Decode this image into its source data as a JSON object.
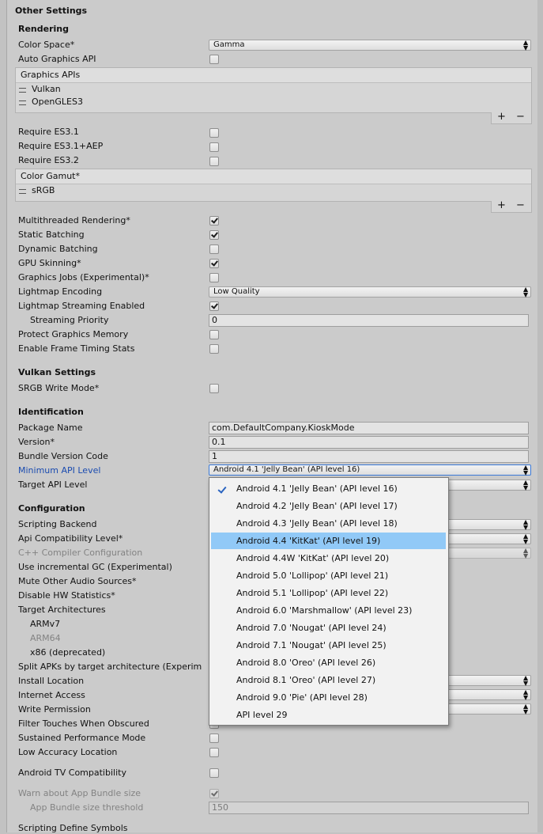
{
  "section_title": "Other Settings",
  "rendering": {
    "header": "Rendering",
    "color_space_label": "Color Space*",
    "color_space_value": "Gamma",
    "auto_graphics_api_label": "Auto Graphics API",
    "auto_graphics_api": false,
    "graphics_apis_header": "Graphics APIs",
    "graphics_apis": [
      "Vulkan",
      "OpenGLES3"
    ],
    "require_es31_label": "Require ES3.1",
    "require_es31_aep_label": "Require ES3.1+AEP",
    "require_es32_label": "Require ES3.2",
    "color_gamut_header": "Color Gamut*",
    "color_gamut": [
      "sRGB"
    ],
    "multithreaded_label": "Multithreaded Rendering*",
    "static_batching_label": "Static Batching",
    "dynamic_batching_label": "Dynamic Batching",
    "gpu_skinning_label": "GPU Skinning*",
    "graphics_jobs_label": "Graphics Jobs (Experimental)*",
    "lightmap_encoding_label": "Lightmap Encoding",
    "lightmap_encoding_value": "Low Quality",
    "lightmap_streaming_label": "Lightmap Streaming Enabled",
    "streaming_priority_label": "Streaming Priority",
    "streaming_priority_value": "0",
    "protect_graphics_memory_label": "Protect Graphics Memory",
    "frame_timing_label": "Enable Frame Timing Stats"
  },
  "vulkan": {
    "header": "Vulkan Settings",
    "srgb_write_label": "SRGB Write Mode*"
  },
  "identification": {
    "header": "Identification",
    "package_name_label": "Package Name",
    "package_name_value": "com.DefaultCompany.KioskMode",
    "version_label": "Version*",
    "version_value": "0.1",
    "bundle_version_code_label": "Bundle Version Code",
    "bundle_version_code_value": "1",
    "min_api_label": "Minimum API Level",
    "min_api_value": "Android 4.1 'Jelly Bean' (API level 16)",
    "target_api_label": "Target API Level"
  },
  "configuration": {
    "header": "Configuration",
    "scripting_backend_label": "Scripting Backend",
    "api_compat_label": "Api Compatibility Level*",
    "cpp_compiler_label": "C++ Compiler Configuration",
    "incremental_gc_label": "Use incremental GC (Experimental)",
    "mute_audio_label": "Mute Other Audio Sources*",
    "disable_hw_stats_label": "Disable HW Statistics*",
    "target_arch_label": "Target Architectures",
    "armv7_label": "ARMv7",
    "arm64_label": "ARM64",
    "x86_label": "x86 (deprecated)",
    "split_apks_label": "Split APKs by target architecture (Experim",
    "install_location_label": "Install Location",
    "internet_access_label": "Internet Access",
    "write_permission_label": "Write Permission",
    "filter_touches_label": "Filter Touches When Obscured",
    "sustained_perf_label": "Sustained Performance Mode",
    "low_accuracy_label": "Low Accuracy Location",
    "android_tv_label": "Android TV Compatibility",
    "warn_bundle_label": "Warn about App Bundle size",
    "bundle_threshold_label": "App Bundle size threshold",
    "bundle_threshold_value": "150",
    "scripting_define_label": "Scripting Define Symbols"
  },
  "api_dropdown": {
    "options": [
      "Android 4.1 'Jelly Bean' (API level 16)",
      "Android 4.2 'Jelly Bean' (API level 17)",
      "Android 4.3 'Jelly Bean' (API level 18)",
      "Android 4.4 'KitKat' (API level 19)",
      "Android 4.4W 'KitKat' (API level 20)",
      "Android 5.0 'Lollipop' (API level 21)",
      "Android 5.1 'Lollipop' (API level 22)",
      "Android 6.0 'Marshmallow' (API level 23)",
      "Android 7.0 'Nougat' (API level 24)",
      "Android 7.1 'Nougat' (API level 25)",
      "Android 8.0 'Oreo' (API level 26)",
      "Android 8.1 'Oreo' (API level 27)",
      "Android 9.0 'Pie' (API level 28)",
      "API level 29"
    ],
    "checked_index": 0,
    "highlighted_index": 3
  },
  "list_controls": {
    "add": "+",
    "remove": "−"
  },
  "colors": {
    "highlight": "#91c9f7",
    "panel": "#cbcbcb",
    "link_label": "#1a4bb0"
  }
}
